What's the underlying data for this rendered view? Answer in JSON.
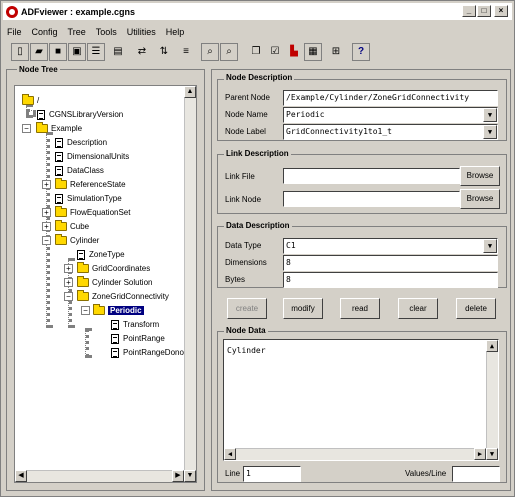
{
  "window": {
    "title": "ADFviewer : example.cgns",
    "minimize": "_",
    "maximize": "□",
    "close": "×"
  },
  "menu": [
    "File",
    "Config",
    "Tree",
    "Tools",
    "Utilities",
    "Help"
  ],
  "toolbar": {
    "icons": [
      "new-file-icon",
      "open-folder-icon",
      "save-icon",
      "export-icon",
      "properties-icon",
      "spreadsheet-icon",
      "move-icon",
      "transfer-icon",
      "compare-icon",
      "find-icon",
      "find-next-icon",
      "copy-icon",
      "check-icon",
      "plot-icon",
      "grid-icon",
      "filter-icon",
      "help-icon"
    ],
    "help_label": "?"
  },
  "tree": {
    "title": "Node Tree",
    "nodes": [
      {
        "label": "/",
        "type": "folder"
      },
      {
        "label": "CGNSLibraryVersion",
        "type": "doc"
      },
      {
        "label": "Example",
        "type": "folder"
      },
      {
        "label": "Description",
        "type": "doc"
      },
      {
        "label": "DimensionalUnits",
        "type": "doc"
      },
      {
        "label": "DataClass",
        "type": "doc"
      },
      {
        "label": "ReferenceState",
        "type": "folder"
      },
      {
        "label": "SimulationType",
        "type": "doc"
      },
      {
        "label": "FlowEquationSet",
        "type": "folder"
      },
      {
        "label": "Cube",
        "type": "folder"
      },
      {
        "label": "Cylinder",
        "type": "folder"
      },
      {
        "label": "ZoneType",
        "type": "doc"
      },
      {
        "label": "GridCoordinates",
        "type": "folder"
      },
      {
        "label": "Cylinder Solution",
        "type": "folder"
      },
      {
        "label": "ZoneGridConnectivity",
        "type": "folder"
      },
      {
        "label": "Periodic",
        "type": "folder",
        "selected": true
      },
      {
        "label": "Transform",
        "type": "doc"
      },
      {
        "label": "PointRange",
        "type": "doc"
      },
      {
        "label": "PointRangeDonor",
        "type": "doc"
      }
    ]
  },
  "node_description": {
    "title": "Node Description",
    "parent_label": "Parent Node",
    "parent_value": "/Example/Cylinder/ZoneGridConnectivity",
    "name_label": "Node Name",
    "name_value": "Periodic",
    "node_label_label": "Node Label",
    "node_label_value": "GridConnectivity1to1_t"
  },
  "link_description": {
    "title": "Link Description",
    "file_label": "Link File",
    "file_value": "",
    "node_label": "Link Node",
    "node_value": "",
    "browse": "Browse"
  },
  "data_description": {
    "title": "Data Description",
    "type_label": "Data Type",
    "type_value": "C1",
    "dimensions_label": "Dimensions",
    "dimensions_value": "8",
    "bytes_label": "Bytes",
    "bytes_value": "8"
  },
  "actions": {
    "create": "create",
    "modify": "modify",
    "read": "read",
    "clear": "clear",
    "delete": "delete"
  },
  "node_data": {
    "title": "Node Data",
    "content": "Cylinder",
    "line_label": "Line",
    "line_value": "1",
    "values_label": "Values/Line",
    "values_value": ""
  }
}
